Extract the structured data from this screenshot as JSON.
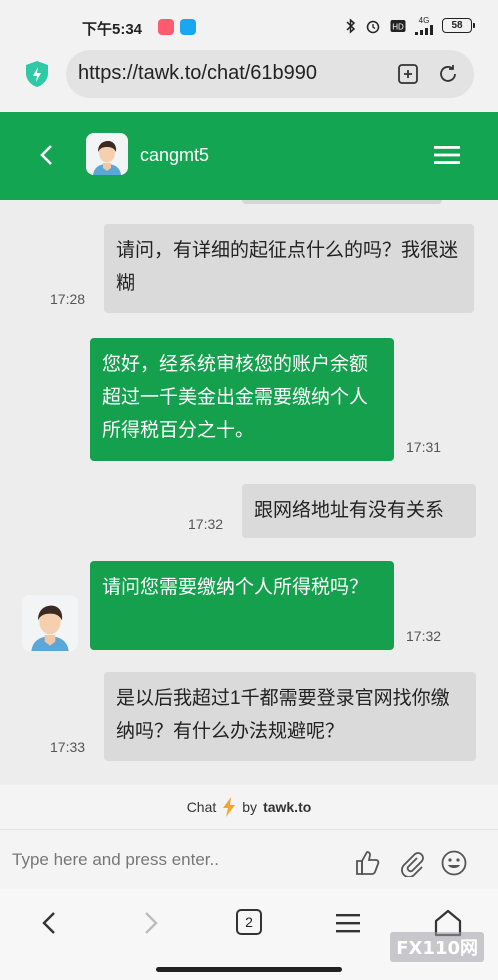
{
  "status_bar": {
    "time": "下午5:34",
    "network_label": "4G",
    "battery": "58"
  },
  "browser": {
    "url": "https://tawk.to/chat/61b990"
  },
  "chat_header": {
    "agent_name": "cangmt5"
  },
  "messages": [
    {
      "from": "visitor",
      "text": "请问，有详细的起征点什么的吗？我很迷糊",
      "time": "17:28"
    },
    {
      "from": "agent",
      "text": "您好，经系统审核您的账户余额超过一千美金出金需要缴纳个人所得税百分之十。",
      "time": "17:31"
    },
    {
      "from": "visitor",
      "text": "跟网络地址有没有关系",
      "time": "17:32"
    },
    {
      "from": "agent",
      "text": "请问您需要缴纳个人所得税吗？",
      "time": "17:32"
    },
    {
      "from": "visitor",
      "text": "是以后我超过1千都需要登录官网找你缴纳吗？有什么办法规避呢？",
      "time": "17:33"
    }
  ],
  "powered_by": {
    "prefix": "Chat",
    "by": "by",
    "brand": "tawk.to"
  },
  "input": {
    "placeholder": "Type here and press enter.."
  },
  "nav": {
    "tab_count": "2"
  },
  "watermark": "FX110网",
  "colors": {
    "header_green": "#13a552",
    "agent_bubble": "#15a04e",
    "visitor_bubble": "#dadada"
  }
}
